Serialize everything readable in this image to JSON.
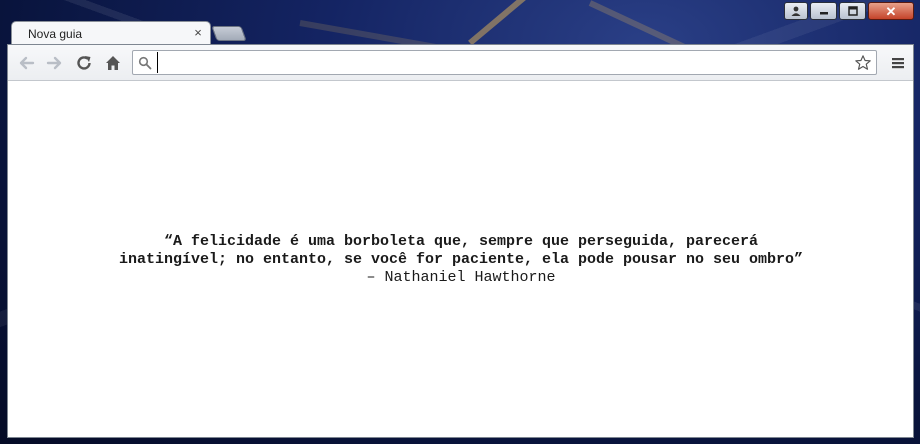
{
  "tab": {
    "title": "Nova guia",
    "close_glyph": "×"
  },
  "caption_buttons": [
    "user-icon",
    "minimize-icon",
    "maximize-icon",
    "close-icon"
  ],
  "toolbar": {
    "icons": [
      "back-arrow-icon",
      "forward-arrow-icon",
      "reload-icon",
      "home-icon",
      "star-icon",
      "menu-icon"
    ]
  },
  "omnibox": {
    "value": "",
    "placeholder": ""
  },
  "quote": {
    "text": "“A felicidade é uma borboleta que, sempre que perseguida, parecerá inatingível; no entanto, se você for paciente, ela pode pousar no seu ombro”",
    "author": " – Nathaniel Hawthorne"
  },
  "colors": {
    "window_bg": "#ffffff",
    "toolbar_bg": "#eceef1",
    "close_button": "#c4432a",
    "desktop": "#142463"
  }
}
